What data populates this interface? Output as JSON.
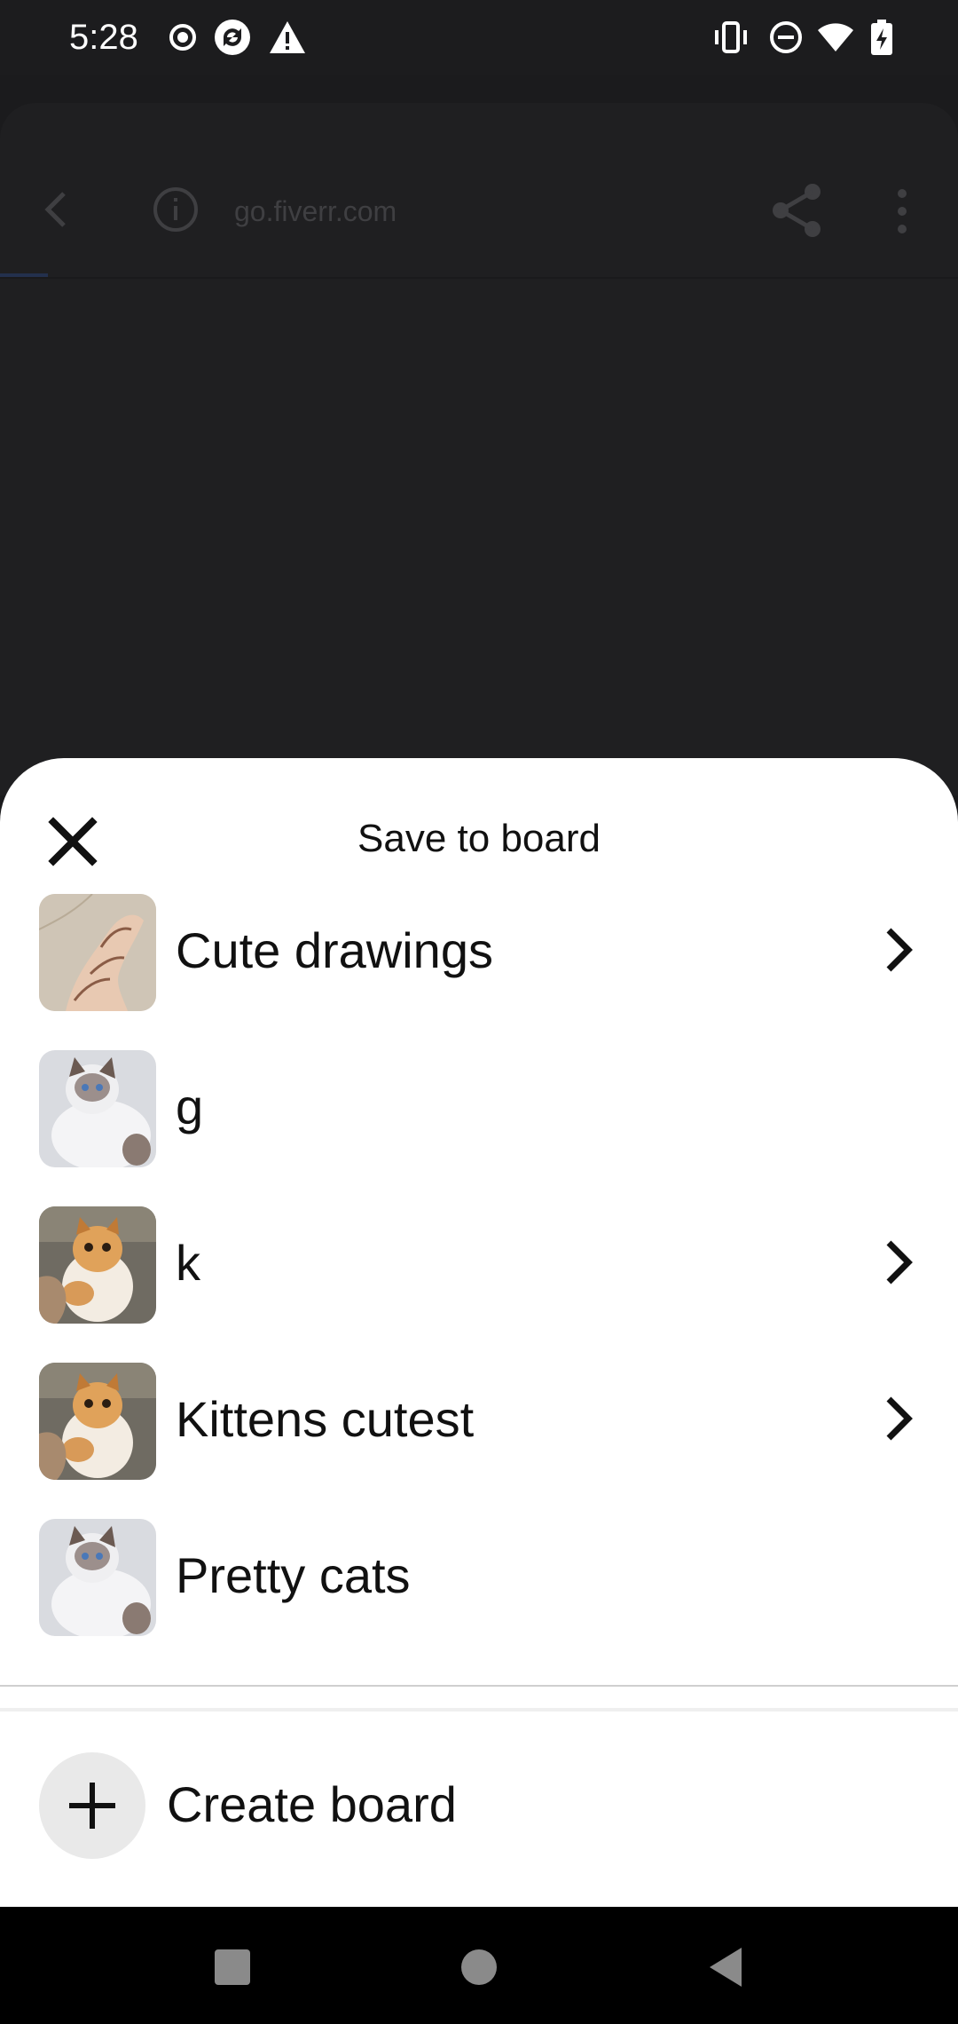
{
  "status_bar": {
    "time": "5:28",
    "left_icons": [
      "record-icon",
      "sync-icon",
      "warning-icon"
    ],
    "right_icons": [
      "vibrate-icon",
      "do-not-disturb-icon",
      "wifi-icon",
      "battery-charging-icon"
    ]
  },
  "browser": {
    "url": "go.fiverr.com"
  },
  "sheet": {
    "title": "Save to board",
    "boards": [
      {
        "name": "Cute drawings",
        "has_chevron": true,
        "thumb": "drawing"
      },
      {
        "name": "g",
        "has_chevron": false,
        "thumb": "white-cat"
      },
      {
        "name": "k",
        "has_chevron": true,
        "thumb": "orange-kitten"
      },
      {
        "name": "Kittens cutest",
        "has_chevron": true,
        "thumb": "orange-kitten"
      },
      {
        "name": "Pretty cats",
        "has_chevron": false,
        "thumb": "white-cat"
      }
    ],
    "create_label": "Create board"
  },
  "colors": {
    "sheet_bg": "#ffffff",
    "backdrop": "#1f1f21",
    "plus_bg": "#e9e9e9",
    "text": "#111111"
  }
}
